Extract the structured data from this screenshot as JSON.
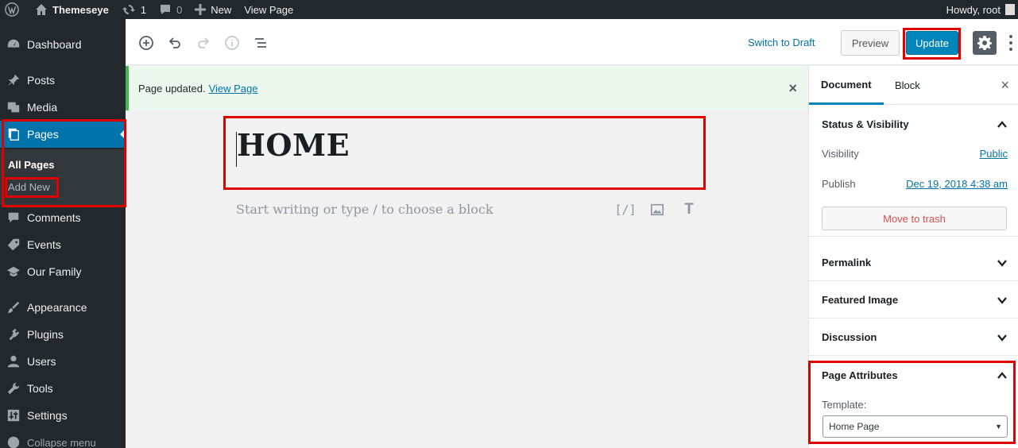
{
  "adminbar": {
    "site_name": "Themeseye",
    "updates_count": "1",
    "comments_count": "0",
    "new_label": "New",
    "view_page_label": "View Page",
    "howdy": "Howdy, root"
  },
  "sidebar": {
    "items": [
      {
        "label": "Dashboard",
        "icon": "dashboard-icon"
      },
      {
        "label": "Posts",
        "icon": "pin-icon"
      },
      {
        "label": "Media",
        "icon": "media-icon"
      },
      {
        "label": "Pages",
        "icon": "pages-icon",
        "active": true
      },
      {
        "label": "Comments",
        "icon": "comment-icon"
      },
      {
        "label": "Events",
        "icon": "tag-icon"
      },
      {
        "label": "Our Family",
        "icon": "graduation-cap-icon"
      },
      {
        "label": "Appearance",
        "icon": "paintbrush-icon"
      },
      {
        "label": "Plugins",
        "icon": "plugin-icon"
      },
      {
        "label": "Users",
        "icon": "user-icon"
      },
      {
        "label": "Tools",
        "icon": "wrench-icon"
      },
      {
        "label": "Settings",
        "icon": "settings-icon"
      }
    ],
    "submenu": {
      "all_pages": "All Pages",
      "add_new": "Add New"
    },
    "collapse_label": "Collapse menu"
  },
  "header": {
    "switch_to_draft": "Switch to Draft",
    "preview_label": "Preview",
    "update_label": "Update"
  },
  "notice": {
    "text": "Page updated.",
    "link": "View Page",
    "close": "×"
  },
  "editor": {
    "title": "HOME",
    "placeholder": "Start writing or type / to choose a block",
    "shortcode_glyph": "[/]",
    "heading_glyph": "T"
  },
  "panel": {
    "tab_document": "Document",
    "tab_block": "Block",
    "close": "×",
    "status_visibility": "Status & Visibility",
    "visibility_label": "Visibility",
    "visibility_value": "Public",
    "publish_label": "Publish",
    "publish_value": "Dec 19, 2018 4:38 am",
    "move_to_trash": "Move to trash",
    "permalink": "Permalink",
    "featured_image": "Featured Image",
    "discussion": "Discussion",
    "page_attributes": "Page Attributes",
    "template_label": "Template:",
    "template_value": "Home Page"
  },
  "colors": {
    "admin_dark": "#23282d",
    "accent_blue": "#0073aa",
    "update_blue": "#0085ba",
    "highlight_red": "#e00000",
    "notice_green": "#46b450"
  }
}
